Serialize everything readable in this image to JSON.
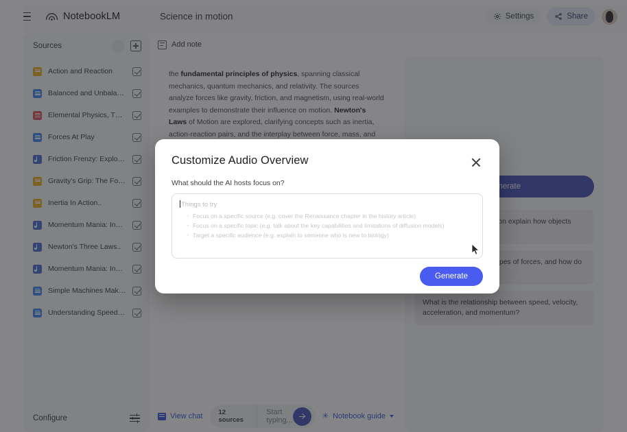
{
  "app": {
    "brand": "NotebookLM",
    "menu_icon": "hamburger-icon",
    "notebook_title": "Science in motion"
  },
  "topbar": {
    "settings_label": "Settings",
    "settings_icon": "gear-icon",
    "share_label": "Share",
    "share_icon": "share-icon",
    "avatar": "user-avatar"
  },
  "sidebar": {
    "header": "Sources",
    "add_icon": "add-source-icon",
    "configure_label": "Configure",
    "configure_icon": "sliders-icon",
    "sources": [
      {
        "title": "Action and Reaction",
        "kind": "slide",
        "checked": true
      },
      {
        "title": "Balanced and Unbalance..",
        "kind": "doc",
        "checked": true
      },
      {
        "title": "Elemental Physics, Third..",
        "kind": "pdf",
        "checked": true
      },
      {
        "title": "Forces At Play",
        "kind": "doc",
        "checked": true
      },
      {
        "title": "Friction Frenzy: Explorin..",
        "kind": "audio",
        "checked": true
      },
      {
        "title": "Gravity's Grip: The Force..",
        "kind": "slide",
        "checked": true
      },
      {
        "title": "Inertia In Action..",
        "kind": "slide",
        "checked": true
      },
      {
        "title": "Momentum Mania: Inves..",
        "kind": "audio",
        "checked": true
      },
      {
        "title": "Newton's Three Laws..",
        "kind": "audio",
        "checked": true
      },
      {
        "title": "Momentum Mania: Inves..",
        "kind": "audio",
        "checked": true
      },
      {
        "title": "Simple Machines Make..",
        "kind": "doc",
        "checked": true
      },
      {
        "title": "Understanding Speed, Ve..",
        "kind": "doc",
        "checked": true
      }
    ]
  },
  "center": {
    "add_note_label": "Add note",
    "add_note_icon": "note-icon",
    "summary_html": "the <b>fundamental principles of physics</b>, spanning classical mechanics, quantum mechanics, and relativity. The sources analyze forces like gravity, friction, and magnetism, using real-world examples to demonstrate their influence on motion. <b>Newton's Laws</b> of Motion are explored, clarifying concepts such as inertia, action-reaction pairs, and the interplay between force, mass, and acceleration. Momentum's relationship with mass and velocity is also examined in the sources."
  },
  "chatbar": {
    "view_chat_label": "View chat",
    "view_chat_icon": "chat-icon",
    "sources_badge": "12 sources",
    "input_placeholder": "Start typing...",
    "input_value": "",
    "send_icon": "send-arrow-icon",
    "notebook_guide_label": "Notebook guide",
    "notebook_guide_icon": "sparkle-icon",
    "notebook_guide_chevron": "chevron-down-icon"
  },
  "right_panel": {
    "generate_label": "Generate",
    "chips": [
      "How do forces and motion explain how objects move and interact?",
      "What are the different types of forces, and how do they affect objects?",
      "What is the relationship between speed, velocity, acceleration, and momentum?"
    ]
  },
  "modal": {
    "title": "Customize Audio Overview",
    "close_icon": "close-icon",
    "subtitle": "What should the AI hosts focus on?",
    "input_value": "",
    "placeholder_title": "Things to try",
    "placeholder_items": [
      "Focus on a specific source (e.g. cover the Renaissance chapter in the history article)",
      "Focus on a specific topic (e.g. talk about the key capabilities and limitations of diffusion models)",
      "Target a specific audience (e.g. explain to someone who is new to biology)"
    ],
    "generate_label": "Generate"
  },
  "colors": {
    "accent_blue": "#4a5bf0",
    "brand_indigo": "#4656b8",
    "link_blue": "#3b5bdb",
    "scrim": "rgba(32,33,36,0.55)"
  }
}
